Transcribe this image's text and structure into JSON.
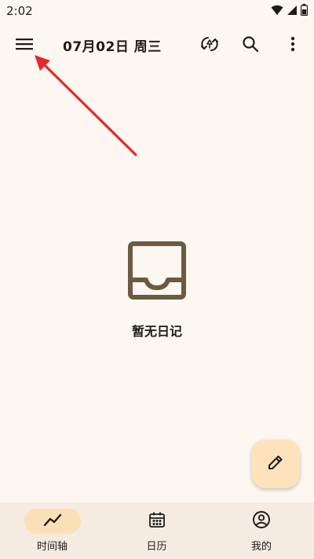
{
  "status_bar": {
    "time": "2:02",
    "icons": [
      "wifi-icon",
      "cell-signal-icon",
      "battery-icon"
    ]
  },
  "top_bar": {
    "menu_icon": "menu-icon",
    "title": "07月02日 周三",
    "actions": [
      "sync-icon",
      "search-icon",
      "more-vert-icon"
    ]
  },
  "empty_state": {
    "icon": "inbox-tray-icon",
    "message": "暂无日记"
  },
  "fab": {
    "icon": "pencil-icon"
  },
  "bottom_nav": {
    "items": [
      {
        "label": "时间轴",
        "icon": "timeline-icon",
        "active": true
      },
      {
        "label": "日历",
        "icon": "calendar-icon",
        "active": false
      },
      {
        "label": "我的",
        "icon": "account-circle-icon",
        "active": false
      }
    ]
  },
  "annotation": {
    "type": "red-arrow",
    "target": "menu-button",
    "color": "#e8262b"
  },
  "colors": {
    "background": "#fdf7f1",
    "fab": "#fde2bb",
    "nav_background": "#f5ebe0",
    "nav_active_indicator": "#fbdfb8",
    "empty_icon": "#6e5a40"
  }
}
